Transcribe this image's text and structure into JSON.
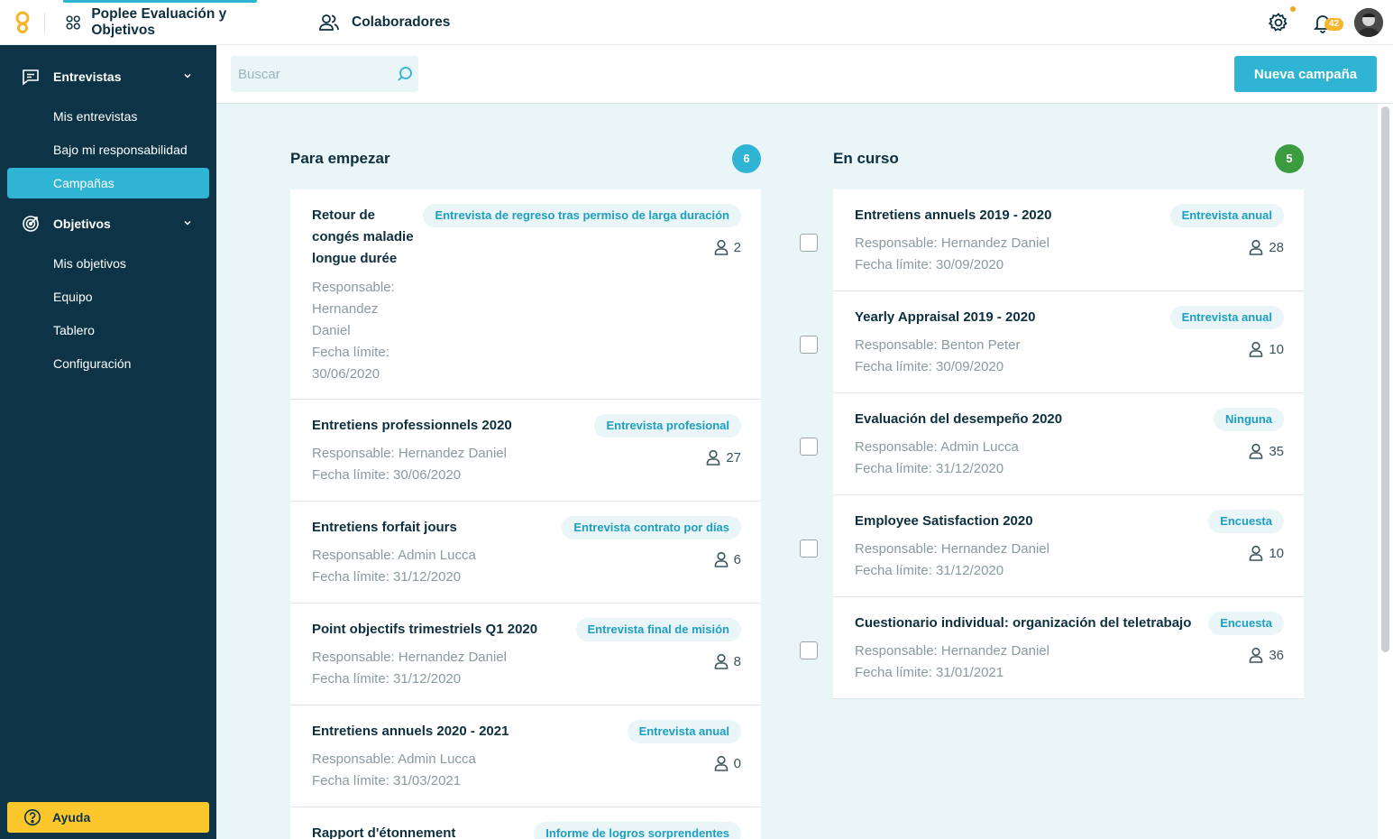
{
  "topbar": {
    "app_title": "Poplee Evaluación y Objetivos",
    "collaborators_label": "Colaboradores",
    "notification_count": "42"
  },
  "sidebar": {
    "sections": [
      {
        "label": "Entrevistas",
        "items": [
          "Mis entrevistas",
          "Bajo mi responsabilidad",
          "Campañas"
        ]
      },
      {
        "label": "Objetivos",
        "items": [
          "Mis objetivos",
          "Equipo",
          "Tablero",
          "Configuración"
        ]
      }
    ],
    "active_item": "Campañas",
    "help_label": "Ayuda"
  },
  "toolbar": {
    "search_placeholder": "Buscar",
    "new_campaign_label": "Nueva campaña"
  },
  "columns": [
    {
      "title": "Para empezar",
      "count": "6",
      "badge_color": "#2fb4d3",
      "cards": [
        {
          "title": "Retour de congés maladie longue durée",
          "tag": "Entrevista de regreso tras permiso de larga duración",
          "responsable": "Responsable: Hernandez Daniel",
          "deadline": "Fecha límite: 30/06/2020",
          "people": "2"
        },
        {
          "title": "Entretiens professionnels 2020",
          "tag": "Entrevista profesional",
          "responsable": "Responsable: Hernandez Daniel",
          "deadline": "Fecha límite: 30/06/2020",
          "people": "27"
        },
        {
          "title": "Entretiens forfait jours",
          "tag": "Entrevista contrato por días",
          "responsable": "Responsable: Admin Lucca",
          "deadline": "Fecha límite: 31/12/2020",
          "people": "6"
        },
        {
          "title": "Point objectifs trimestriels Q1 2020",
          "tag": "Entrevista final de misión",
          "responsable": "Responsable: Hernandez Daniel",
          "deadline": "Fecha límite: 31/12/2020",
          "people": "8"
        },
        {
          "title": "Entretiens annuels 2020 - 2021",
          "tag": "Entrevista anual",
          "responsable": "Responsable: Admin Lucca",
          "deadline": "Fecha límite: 31/03/2021",
          "people": "0"
        },
        {
          "title": "Rapport d'étonnement",
          "tag": "Informe de logros sorprendentes"
        }
      ]
    },
    {
      "title": "En curso",
      "count": "5",
      "badge_color": "#3b9b3f",
      "cards": [
        {
          "title": "Entretiens annuels 2019 - 2020",
          "tag": "Entrevista anual",
          "responsable": "Responsable: Hernandez Daniel",
          "deadline": "Fecha límite: 30/09/2020",
          "people": "28"
        },
        {
          "title": "Yearly Appraisal 2019 - 2020",
          "tag": "Entrevista anual",
          "responsable": "Responsable: Benton Peter",
          "deadline": "Fecha límite: 30/09/2020",
          "people": "10"
        },
        {
          "title": "Evaluación del desempeño 2020",
          "tag": "Ninguna",
          "responsable": "Responsable: Admin Lucca",
          "deadline": "Fecha límite: 31/12/2020",
          "people": "35"
        },
        {
          "title": "Employee Satisfaction 2020",
          "tag": "Encuesta",
          "responsable": "Responsable: Hernandez Daniel",
          "deadline": "Fecha límite: 31/12/2020",
          "people": "10"
        },
        {
          "title": "Cuestionario individual: organización del teletrabajo",
          "tag": "Encuesta",
          "responsable": "Responsable: Hernandez Daniel",
          "deadline": "Fecha límite: 31/01/2021",
          "people": "36"
        }
      ]
    }
  ]
}
